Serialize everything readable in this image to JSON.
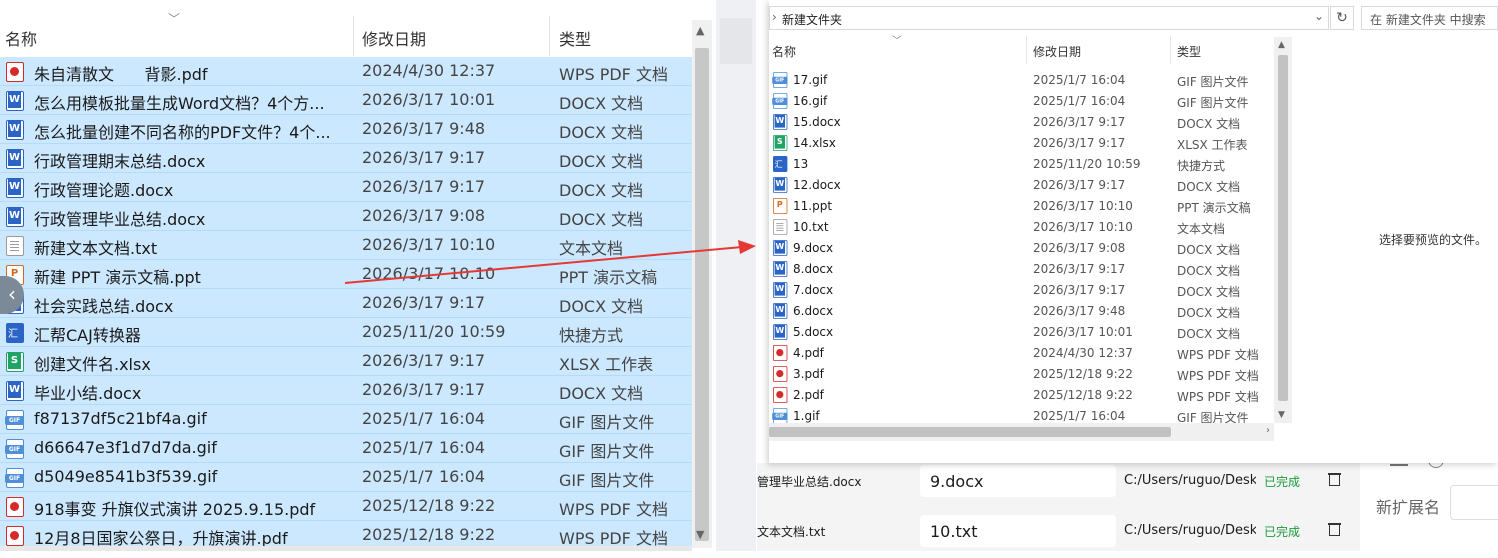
{
  "left": {
    "columns": {
      "name": "名称",
      "date": "修改日期",
      "type": "类型"
    },
    "rows": [
      {
        "icon": "pdf",
        "name": "朱自清散文      背影.pdf",
        "date": "2024/4/30 12:37",
        "type": "WPS PDF 文档"
      },
      {
        "icon": "docx",
        "name": "怎么用模板批量生成Word文档？4个方...",
        "date": "2026/3/17 10:01",
        "type": "DOCX 文档"
      },
      {
        "icon": "docx",
        "name": "怎么批量创建不同名称的PDF文件？4个...",
        "date": "2026/3/17 9:48",
        "type": "DOCX 文档"
      },
      {
        "icon": "docx",
        "name": "行政管理期末总结.docx",
        "date": "2026/3/17 9:17",
        "type": "DOCX 文档"
      },
      {
        "icon": "docx",
        "name": "行政管理论题.docx",
        "date": "2026/3/17 9:17",
        "type": "DOCX 文档"
      },
      {
        "icon": "docx",
        "name": "行政管理毕业总结.docx",
        "date": "2026/3/17 9:08",
        "type": "DOCX 文档"
      },
      {
        "icon": "txt",
        "name": "新建文本文档.txt",
        "date": "2026/3/17 10:10",
        "type": "文本文档"
      },
      {
        "icon": "ppt",
        "name": "新建 PPT 演示文稿.ppt",
        "date": "2026/3/17 10:10",
        "type": "PPT 演示文稿"
      },
      {
        "icon": "docx",
        "name": "社会实践总结.docx",
        "date": "2026/3/17 9:17",
        "type": "DOCX 文档"
      },
      {
        "icon": "lnk",
        "name": "汇帮CAJ转换器",
        "date": "2025/11/20 10:59",
        "type": "快捷方式"
      },
      {
        "icon": "xlsx",
        "name": "创建文件名.xlsx",
        "date": "2026/3/17 9:17",
        "type": "XLSX 工作表"
      },
      {
        "icon": "docx",
        "name": "毕业小结.docx",
        "date": "2026/3/17 9:17",
        "type": "DOCX 文档"
      },
      {
        "icon": "gif",
        "name": "f87137df5c21bf4a.gif",
        "date": "2025/1/7 16:04",
        "type": "GIF 图片文件"
      },
      {
        "icon": "gif",
        "name": "d66647e3f1d7d7da.gif",
        "date": "2025/1/7 16:04",
        "type": "GIF 图片文件"
      },
      {
        "icon": "gif",
        "name": "d5049e8541b3f539.gif",
        "date": "2025/1/7 16:04",
        "type": "GIF 图片文件"
      },
      {
        "icon": "pdf",
        "name": "918事变 升旗仪式演讲 2025.9.15.pdf",
        "date": "2025/12/18 9:22",
        "type": "WPS PDF 文档"
      },
      {
        "icon": "pdf",
        "name": "12月8日国家公祭日，升旗演讲.pdf",
        "date": "2025/12/18 9:22",
        "type": "WPS PDF 文档"
      }
    ]
  },
  "dialog": {
    "folder": "新建文件夹",
    "search_placeholder": "在 新建文件夹 中搜索",
    "columns": {
      "name": "名称",
      "date": "修改日期",
      "type": "类型"
    },
    "preview_text": "选择要预览的文件。",
    "rows": [
      {
        "icon": "gif",
        "name": "17.gif",
        "date": "2025/1/7 16:04",
        "type": "GIF 图片文件"
      },
      {
        "icon": "gif",
        "name": "16.gif",
        "date": "2025/1/7 16:04",
        "type": "GIF 图片文件"
      },
      {
        "icon": "docx",
        "name": "15.docx",
        "date": "2026/3/17 9:17",
        "type": "DOCX 文档"
      },
      {
        "icon": "xlsx",
        "name": "14.xlsx",
        "date": "2026/3/17 9:17",
        "type": "XLSX 工作表"
      },
      {
        "icon": "lnk",
        "name": "13",
        "date": "2025/11/20 10:59",
        "type": "快捷方式"
      },
      {
        "icon": "docx",
        "name": "12.docx",
        "date": "2026/3/17 9:17",
        "type": "DOCX 文档"
      },
      {
        "icon": "ppt",
        "name": "11.ppt",
        "date": "2026/3/17 10:10",
        "type": "PPT 演示文稿"
      },
      {
        "icon": "txt",
        "name": "10.txt",
        "date": "2026/3/17 10:10",
        "type": "文本文档"
      },
      {
        "icon": "docx",
        "name": "9.docx",
        "date": "2026/3/17 9:08",
        "type": "DOCX 文档"
      },
      {
        "icon": "docx",
        "name": "8.docx",
        "date": "2026/3/17 9:17",
        "type": "DOCX 文档"
      },
      {
        "icon": "docx",
        "name": "7.docx",
        "date": "2026/3/17 9:17",
        "type": "DOCX 文档"
      },
      {
        "icon": "docx",
        "name": "6.docx",
        "date": "2026/3/17 9:48",
        "type": "DOCX 文档"
      },
      {
        "icon": "docx",
        "name": "5.docx",
        "date": "2026/3/17 10:01",
        "type": "DOCX 文档"
      },
      {
        "icon": "pdf",
        "name": "4.pdf",
        "date": "2024/4/30 12:37",
        "type": "WPS PDF 文档"
      },
      {
        "icon": "pdf",
        "name": "3.pdf",
        "date": "2025/12/18 9:22",
        "type": "WPS PDF 文档"
      },
      {
        "icon": "pdf",
        "name": "2.pdf",
        "date": "2025/12/18 9:22",
        "type": "WPS PDF 文档"
      },
      {
        "icon": "gif",
        "name": "1.gif",
        "date": "2025/1/7 16:04",
        "type": "GIF 图片文件"
      }
    ]
  },
  "tasks": [
    {
      "original": "管理毕业总结.docx",
      "new_name": "9.docx",
      "path": "C:/Users/ruguo/Deskt",
      "status": "已完成"
    },
    {
      "original": "文本文档.txt",
      "new_name": "10.txt",
      "path": "C:/Users/ruguo/Deskt",
      "status": "已完成"
    }
  ],
  "right_panel": {
    "ext_label": "新扩展名"
  },
  "colors": {
    "selection": "#cce8ff",
    "arrow": "#e53935",
    "done": "#1a9c3c"
  }
}
